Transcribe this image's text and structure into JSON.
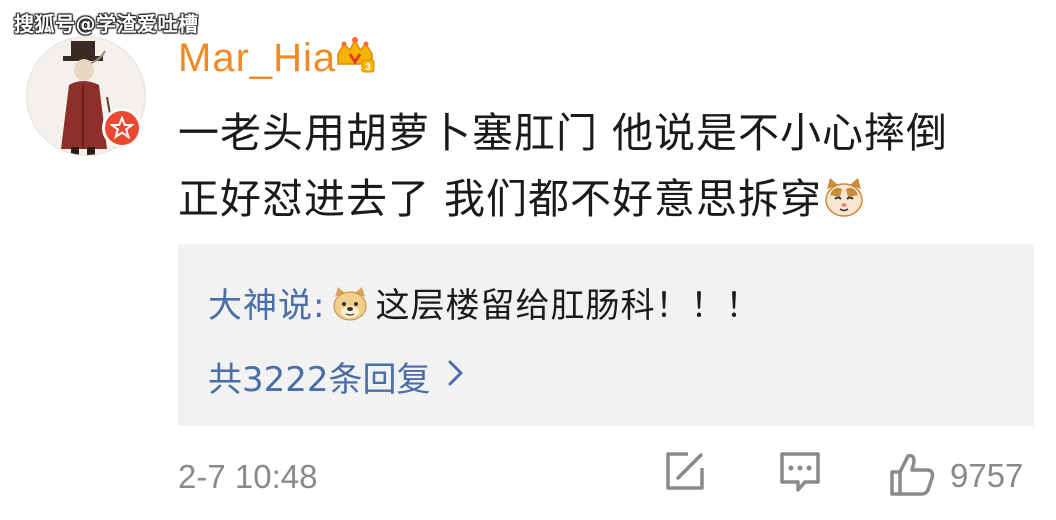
{
  "watermark": "搜狐号@学渣爱吐槽",
  "user": {
    "name": "Mar_Hia"
  },
  "post": {
    "line1": "一老头用胡萝卜塞肛门 他说是不小心摔倒",
    "line2": "正好怼进去了 我们都不好意思拆穿"
  },
  "reply": {
    "author": "大神说:",
    "text": "这层楼留给肛肠科！！！",
    "more_label": "共3222条回复"
  },
  "meta": {
    "timestamp": "2-7 10:48",
    "likes": "9757"
  },
  "icons": {
    "repost": "repost-icon",
    "comment": "comment-icon",
    "like": "thumbs-up-icon"
  },
  "colors": {
    "username": "#f08a24",
    "link": "#4a6ea8",
    "badge": "#e8492f",
    "reply_bg": "#f2f2f2",
    "meta": "#8a8a8a"
  }
}
